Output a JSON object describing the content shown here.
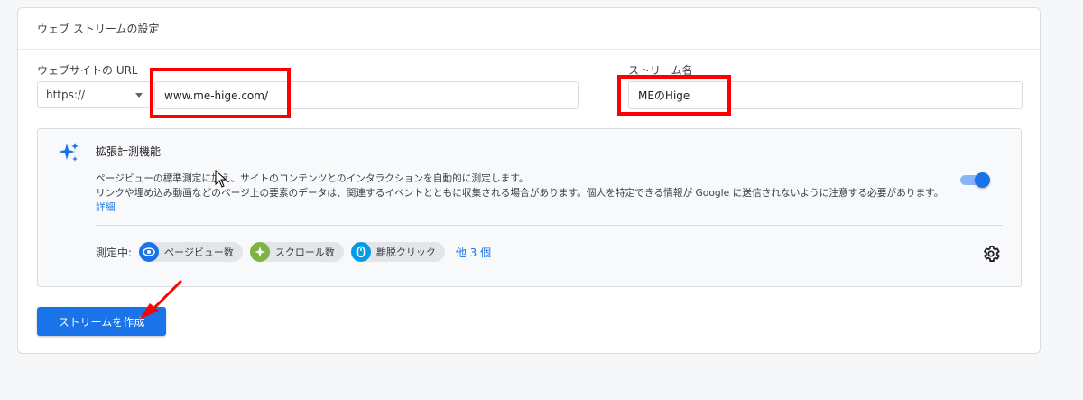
{
  "card": {
    "header_title": "ウェブ ストリームの設定"
  },
  "url_section": {
    "label": "ウェブサイトの URL",
    "protocol_selected": "https://",
    "url_value": "www.me-hige.com/"
  },
  "stream_section": {
    "label": "ストリーム名",
    "stream_name_value": "MEのHige"
  },
  "enhanced_measurement": {
    "title": "拡張計測機能",
    "description_line1": "ページビューの標準測定に加え、サイトのコンテンツとのインタラクションを自動的に測定します。",
    "description_line2": "リンクや埋め込み動画などのページ上の要素のデータは、関連するイベントとともに収集される場合があります。個人を特定できる情報が Google に送信されないように注意する必要があります。",
    "details_link": "詳細",
    "toggle_on": true,
    "measuring_label": "測定中:",
    "chips": [
      {
        "label": "ページビュー数",
        "icon": "eye-icon",
        "color": "#1a73e8"
      },
      {
        "label": "スクロール数",
        "icon": "compass-icon",
        "color": "#7cb342"
      },
      {
        "label": "離脱クリック",
        "icon": "mouse-icon",
        "color": "#039be5"
      }
    ],
    "more_link": "他 3 個"
  },
  "actions": {
    "create_button": "ストリームを作成"
  },
  "colors": {
    "primary": "#1a73e8",
    "annotation_red": "#ff0000"
  }
}
